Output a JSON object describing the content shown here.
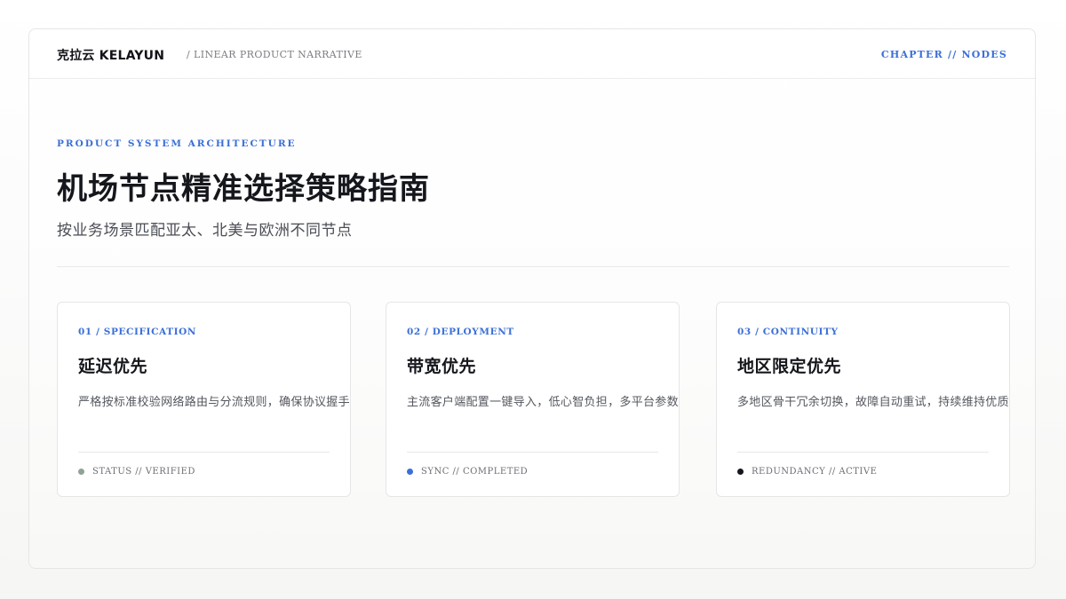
{
  "header": {
    "brand": "克拉云 KELAYUN",
    "crumb": "/ LINEAR PRODUCT NARRATIVE",
    "chapter": "CHAPTER // NODES"
  },
  "hero": {
    "eyebrow": "PRODUCT SYSTEM ARCHITECTURE",
    "title": "机场节点精准选择策略指南",
    "subtitle": "按业务场景匹配亚太、北美与欧洲不同节点"
  },
  "cards": [
    {
      "num": "01 / SPECIFICATION",
      "title": "延迟优先",
      "desc": "严格按标准校验网络路由与分流规则，确保协议握手稳定",
      "status": "STATUS // VERIFIED",
      "dot_color": "#8fa296"
    },
    {
      "num": "02 / DEPLOYMENT",
      "title": "带宽优先",
      "desc": "主流客户端配置一键导入，低心智负担，多平台参数保持一致",
      "status": "SYNC // COMPLETED",
      "dot_color": "#3a6fd8"
    },
    {
      "num": "03 / CONTINUITY",
      "title": "地区限定优先",
      "desc": "多地区骨干冗余切换，故障自动重试，持续维持优质连接体验",
      "status": "REDUNDANCY // ACTIVE",
      "dot_color": "#15171c"
    }
  ]
}
